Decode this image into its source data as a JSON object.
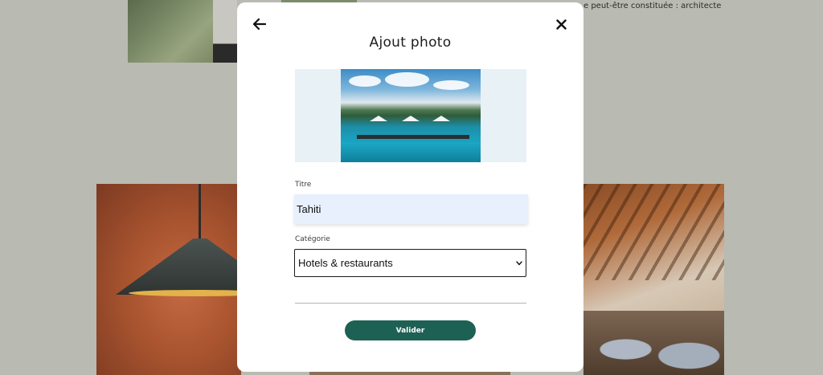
{
  "background": {
    "caption_text": "e peut-être constituée : architecte"
  },
  "modal": {
    "back_icon": "arrow-left-icon",
    "close_icon": "close-icon",
    "title": "Ajout photo",
    "photo_preview_icon": "image-preview",
    "form": {
      "title_label": "Titre",
      "title_value": "Tahiti",
      "category_label": "Catégorie",
      "category_value": "Hotels & restaurants",
      "category_chevron_icon": "chevron-down-icon"
    },
    "submit_label": "Valider"
  },
  "colors": {
    "accent": "#1d6154",
    "overlay": "#b9bab2",
    "input_autofill_bg": "#e8f0fe",
    "photo_frame_bg": "#e8f1f6"
  }
}
